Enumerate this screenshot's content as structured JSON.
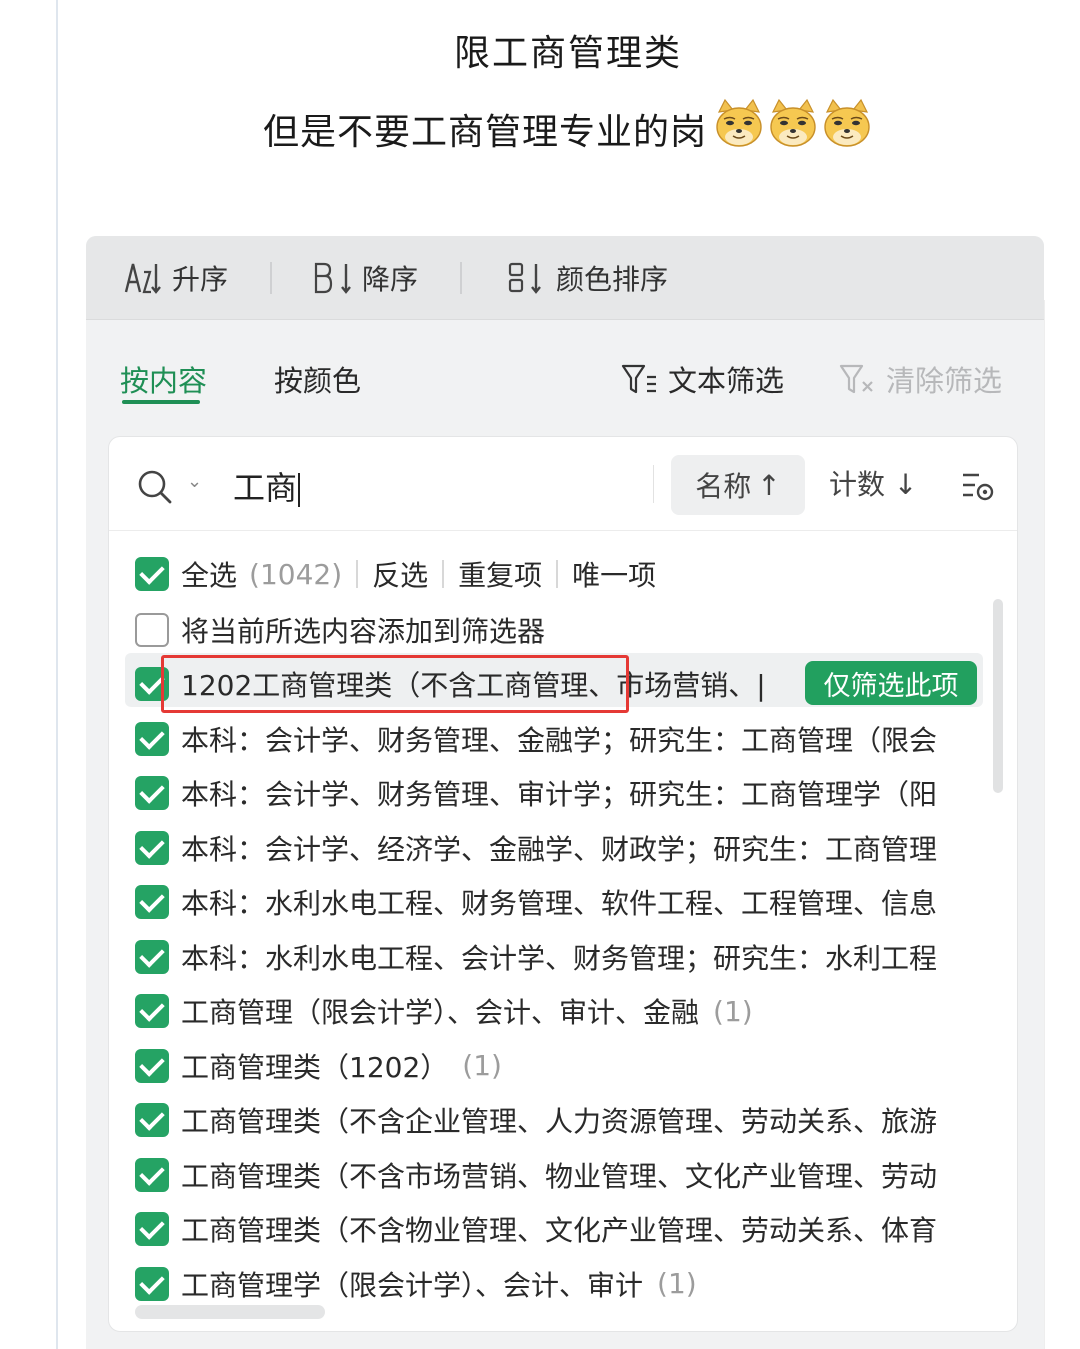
{
  "caption": {
    "line1": "限工商管理类",
    "line2": "但是不要工商管理专业的岗",
    "emojis": [
      "doge-face-icon",
      "doge-face-icon",
      "doge-face-icon"
    ]
  },
  "sortbar": {
    "asc": "升序",
    "desc": "降序",
    "color_sort": "颜色排序"
  },
  "tabs": {
    "by_content": "按内容",
    "by_color": "按颜色",
    "text_filter": "文本筛选",
    "clear_filter": "清除筛选",
    "active": "by_content"
  },
  "search": {
    "value": "工商",
    "name_sort": "名称",
    "name_sort_arrow": "↑",
    "count_sort": "计数",
    "count_sort_arrow": "↓"
  },
  "list": {
    "select_all": {
      "label": "全选",
      "count": "(1042)",
      "checked": true
    },
    "invert": "反选",
    "duplicates": "重复项",
    "unique": "唯一项",
    "add_to_filter": {
      "label": "将当前所选内容添加到筛选器",
      "checked": false
    },
    "only_this_button": "仅筛选此项",
    "items": [
      {
        "label": "1202工商管理类（不含工商管理、市场营销、|",
        "count": "",
        "checked": true
      },
      {
        "label": "本科：会计学、财务管理、金融学；研究生：工商管理（限会",
        "count": "",
        "checked": true
      },
      {
        "label": "本科：会计学、财务管理、审计学；研究生：工商管理学（阳",
        "count": "",
        "checked": true
      },
      {
        "label": "本科：会计学、经济学、金融学、财政学；研究生：工商管理",
        "count": "",
        "checked": true
      },
      {
        "label": "本科：水利水电工程、财务管理、软件工程、工程管理、信息",
        "count": "",
        "checked": true
      },
      {
        "label": "本科：水利水电工程、会计学、财务管理；研究生：水利工程",
        "count": "",
        "checked": true
      },
      {
        "label": "工商管理（限会计学）、会计、审计、金融",
        "count": "(1)",
        "checked": true
      },
      {
        "label": "工商管理类（1202）",
        "count": "(1)",
        "checked": true
      },
      {
        "label": "工商管理类（不含企业管理、人力资源管理、劳动关系、旅游",
        "count": "",
        "checked": true
      },
      {
        "label": "工商管理类（不含市场营销、物业管理、文化产业管理、劳动",
        "count": "",
        "checked": true
      },
      {
        "label": "工商管理类（不含物业管理、文化产业管理、劳动关系、体育",
        "count": "",
        "checked": true
      },
      {
        "label": "工商管理学（限会计学）、会计、审计",
        "count": "(1)",
        "checked": true
      }
    ]
  },
  "colors": {
    "accent": "#22a05f",
    "highlight_border": "#e53935"
  }
}
